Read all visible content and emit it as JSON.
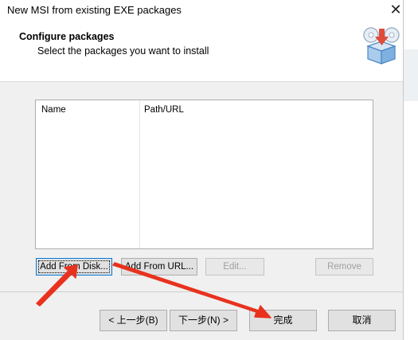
{
  "window": {
    "title": "New MSI from existing EXE packages",
    "close_glyph": "✕"
  },
  "header": {
    "title": "Configure packages",
    "subtitle": "Select the packages you want to install",
    "icon": "package-install-icon"
  },
  "list": {
    "columns": [
      "Name",
      "Path/URL"
    ],
    "rows": []
  },
  "buttons": {
    "add_from_disk": "Add From Disk...",
    "add_from_url": "Add From URL...",
    "edit": "Edit...",
    "remove": "Remove"
  },
  "nav": {
    "back": "< 上一步(B)",
    "next": "下一步(N) >",
    "finish": "完成",
    "cancel": "取消"
  },
  "colors": {
    "annotation_arrow": "#e8321e",
    "focus_border": "#0078d7"
  }
}
